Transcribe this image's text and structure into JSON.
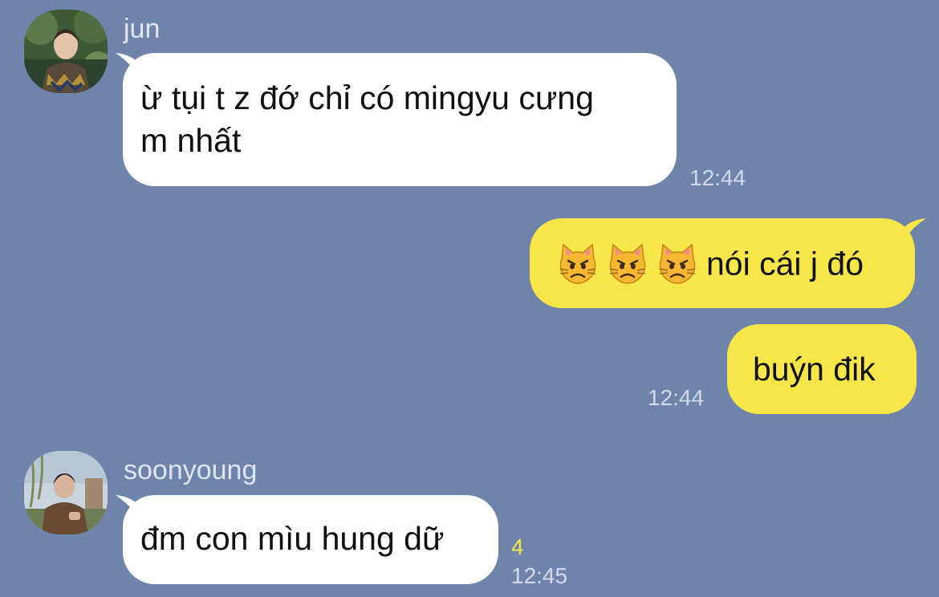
{
  "colors": {
    "background": "#6e84ab",
    "incoming_bubble": "#ffffff",
    "outgoing_bubble": "#f7e64a",
    "unread": "#f4e64a"
  },
  "messages": [
    {
      "sender": "jun",
      "text_line1": "ừ tụi t z đớ chỉ có mingyu cưng",
      "text_line2": "m nhất",
      "time": "12:44"
    },
    {
      "emoji": "pouting-cat-face-icon",
      "emoji_count": 3,
      "text": "nói cái j đó"
    },
    {
      "text": "buýn đik",
      "time": "12:44"
    },
    {
      "sender": "soonyoung",
      "text": "đm con mìu hung dữ",
      "unread": "4",
      "time": "12:45"
    }
  ]
}
